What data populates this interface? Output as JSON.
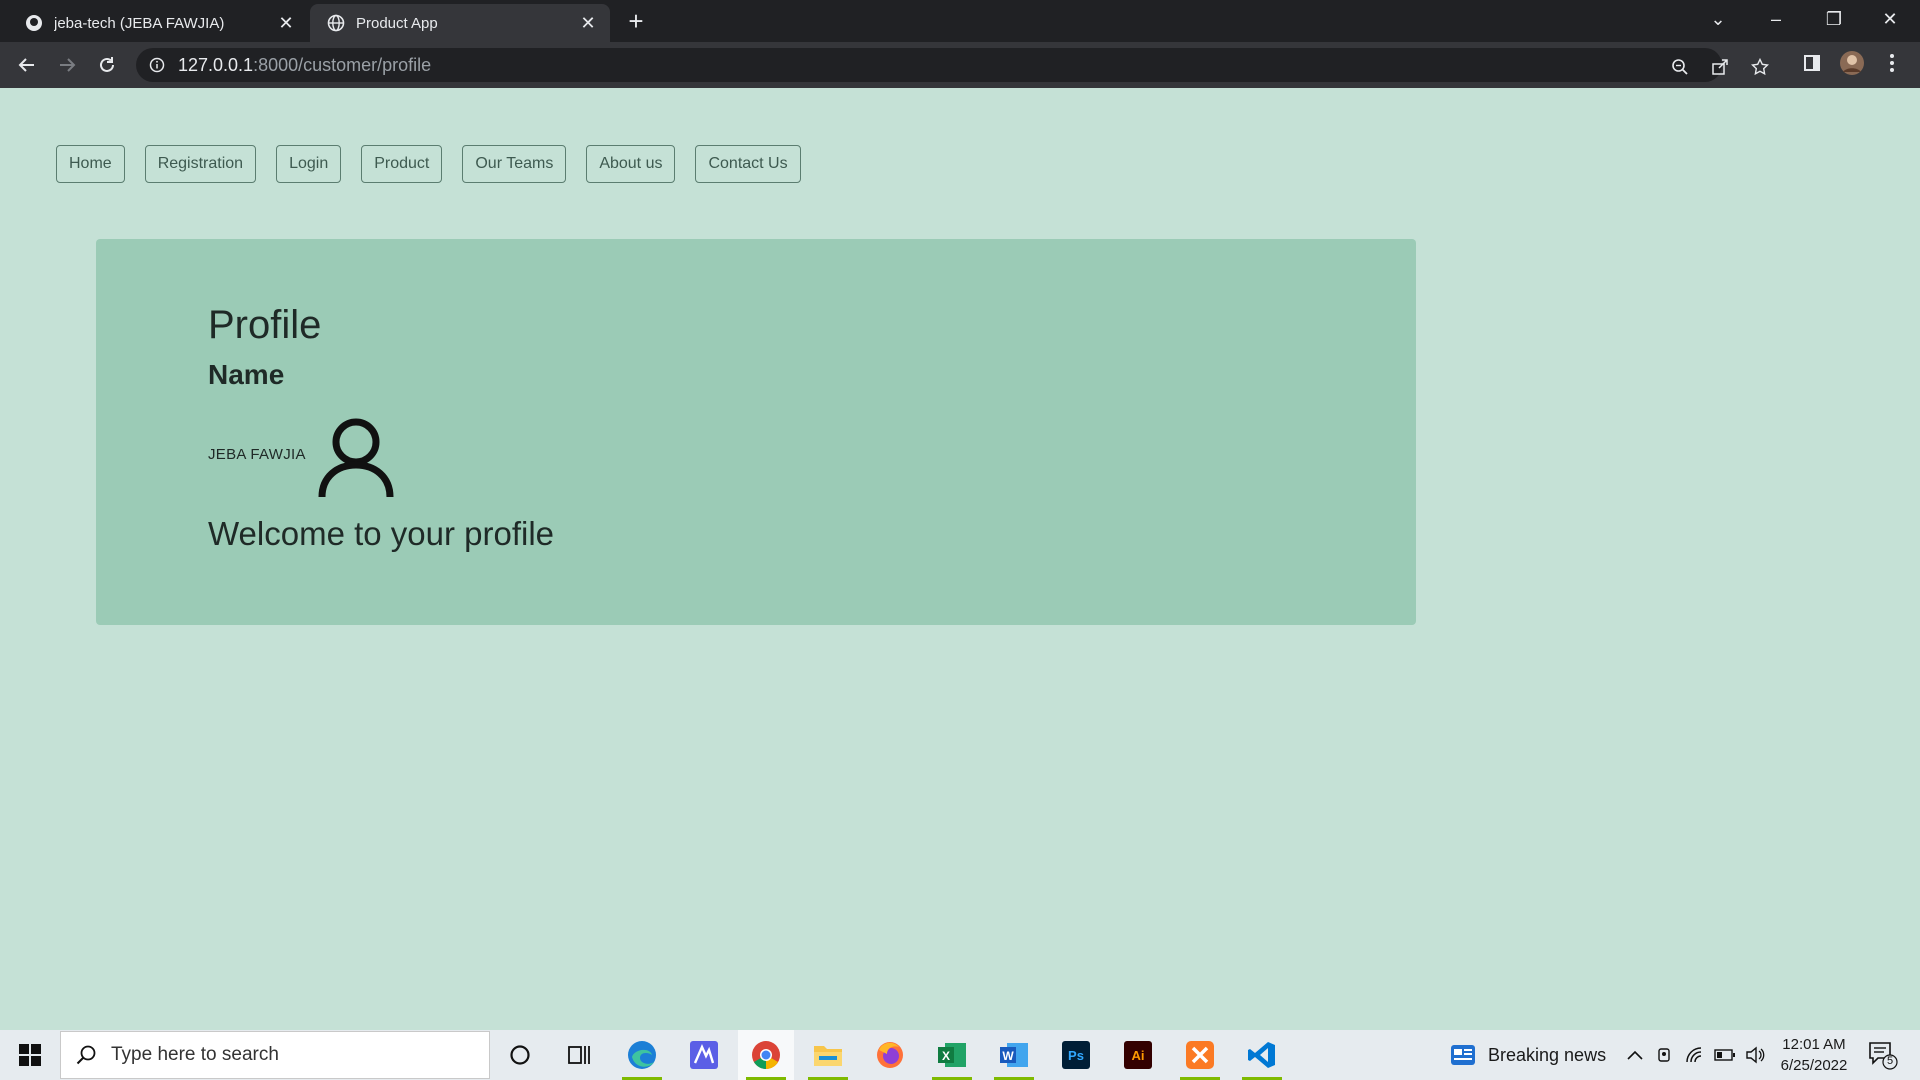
{
  "browser": {
    "tabs": [
      {
        "title": "jeba-tech (JEBA FAWJIA)",
        "active": false
      },
      {
        "title": "Product App",
        "active": true
      }
    ],
    "address": {
      "host": "127.0.0.1",
      "path": ":8000/customer/profile"
    }
  },
  "nav": {
    "items": [
      "Home",
      "Registration",
      "Login",
      "Product",
      "Our Teams",
      "About us",
      "Contact Us"
    ]
  },
  "profile": {
    "heading": "Profile",
    "name_label": "Name",
    "user_name": "JEBA FAWJIA",
    "welcome": "Welcome to your profile"
  },
  "taskbar": {
    "search_placeholder": "Type here to search",
    "news": "Breaking news",
    "time": "12:01 AM",
    "date": "6/25/2022",
    "notification_count": "5",
    "apps": [
      "cortana-icon",
      "task-view-icon",
      "edge-icon",
      "marketing-app-icon",
      "chrome-icon",
      "file-explorer-icon",
      "firefox-icon",
      "excel-icon",
      "word-icon",
      "photoshop-icon",
      "illustrator-icon",
      "xampp-icon",
      "vscode-icon"
    ]
  },
  "colors": {
    "page_bg": "#c5e1d6",
    "card_bg": "#9bcbb6",
    "nav_border": "#5b7d70"
  }
}
